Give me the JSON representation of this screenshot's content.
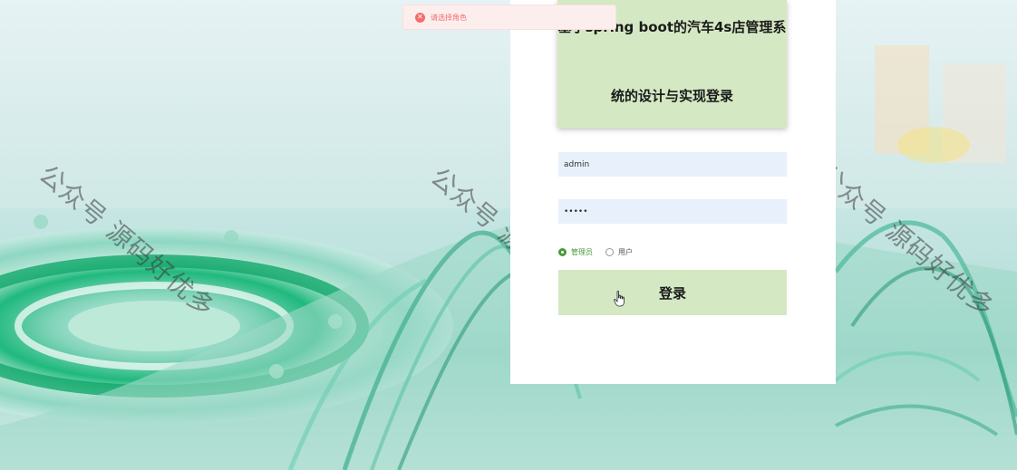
{
  "toast": {
    "icon": "error-circle-icon",
    "message": "请选择角色",
    "color": "#f56c6c"
  },
  "title": {
    "line1": "基于spring boot的汽车4s店管理系",
    "line2": "统的设计与实现登录"
  },
  "form": {
    "username_value": "admin",
    "password_value": "•••••",
    "roles": [
      {
        "label": "管理员",
        "checked": true
      },
      {
        "label": "用户",
        "checked": false
      }
    ],
    "login_label": "登录"
  },
  "watermark": "公众号 源码好优多",
  "colors": {
    "card_bg": "#d4e9c3",
    "input_bg": "#e8f0fb",
    "accent": "#4a9a3a"
  }
}
